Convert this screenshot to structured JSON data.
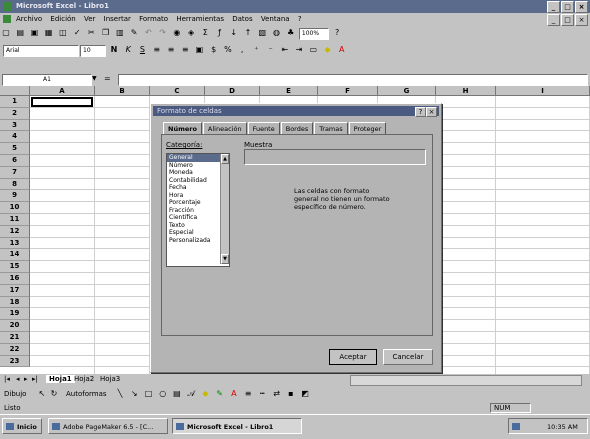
{
  "window": {
    "title": "Microsoft Excel - Libro1",
    "min": "_",
    "max": "□",
    "close": "×"
  },
  "menu": [
    "Archivo",
    "Edición",
    "Ver",
    "Insertar",
    "Formato",
    "Herramientas",
    "Datos",
    "Ventana",
    "?"
  ],
  "format_toolbar": {
    "font": "Arial",
    "size": "10",
    "zoom": "100%"
  },
  "formula_bar": {
    "name_box": "A1",
    "equals": "="
  },
  "columns": [
    "A",
    "B",
    "C",
    "D",
    "E",
    "F",
    "G",
    "H",
    "I"
  ],
  "rows": [
    "1",
    "2",
    "3",
    "4",
    "5",
    "6",
    "7",
    "8",
    "9",
    "10",
    "11",
    "12",
    "13",
    "14",
    "15",
    "16",
    "17",
    "18",
    "19",
    "20",
    "21",
    "22",
    "23"
  ],
  "dialog": {
    "title": "Formato de celdas",
    "help": "?",
    "close": "×",
    "tabs": [
      "Número",
      "Alineación",
      "Fuente",
      "Bordes",
      "Tramas",
      "Proteger"
    ],
    "category_label": "Categoría:",
    "sample_label": "Muestra",
    "categories": [
      "General",
      "Número",
      "Moneda",
      "Contabilidad",
      "Fecha",
      "Hora",
      "Porcentaje",
      "Fracción",
      "Científica",
      "Texto",
      "Especial",
      "Personalizada"
    ],
    "selected_category": "General",
    "description": "Las celdas con formato general no tienen un formato específico de número.",
    "ok": "Aceptar",
    "cancel": "Cancelar"
  },
  "sheet_tabs": [
    "Hoja1",
    "Hoja2",
    "Hoja3"
  ],
  "draw_toolbar": {
    "dibujo": "Dibujo",
    "autoformas": "Autoformas"
  },
  "status": {
    "left": "Listo",
    "num": "NUM"
  },
  "taskbar": {
    "start": "Inicio",
    "tasks": [
      "Adobe PageMaker 6.5 - [C...",
      "Microsoft Excel - Libro1"
    ],
    "clock": "10:35 AM"
  }
}
